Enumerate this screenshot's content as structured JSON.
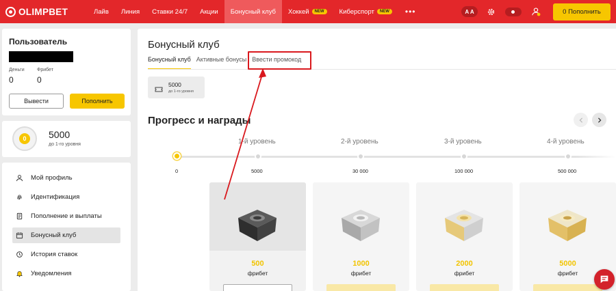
{
  "header": {
    "logo_text": "OLIMPBET",
    "nav": [
      {
        "label": "Лайв"
      },
      {
        "label": "Линия"
      },
      {
        "label": "Ставки 24/7"
      },
      {
        "label": "Акции"
      },
      {
        "label": "Бонусный клуб",
        "active": true
      },
      {
        "label": "Хоккей",
        "badge": "NEW"
      },
      {
        "label": "Киберспорт",
        "badge": "NEW"
      }
    ],
    "more": "•••",
    "font_toggle": "A A",
    "deposit_label": "0 Пополнить"
  },
  "user": {
    "title": "Пользователь",
    "money_label": "Деньги",
    "money_value": "0",
    "freebet_label": "Фрибет",
    "freebet_value": "0",
    "withdraw_label": "Вывести",
    "deposit_label": "Пополнить"
  },
  "bonus_summary": {
    "coin_symbol": "0",
    "points": "5000",
    "subtitle": "до 1-го уровня"
  },
  "menu": [
    {
      "label": "Мой профиль",
      "icon": "profile-icon"
    },
    {
      "label": "Идентификация",
      "icon": "fingerprint-icon"
    },
    {
      "label": "Пополнение и выплаты",
      "icon": "receipt-icon"
    },
    {
      "label": "Бонусный клуб",
      "icon": "calendar-icon",
      "active": true
    },
    {
      "label": "История ставок",
      "icon": "history-icon"
    },
    {
      "label": "Уведомления",
      "icon": "bell-icon"
    }
  ],
  "main": {
    "title": "Бонусный клуб",
    "tabs": [
      {
        "label": "Бонусный клуб",
        "active": true
      },
      {
        "label": "Активные бонусы"
      },
      {
        "label": "Ввести промокод",
        "highlighted": true
      }
    ],
    "points_chip": {
      "value": "5000",
      "subtitle": "до 1-го уровня"
    },
    "section_title": "Прогресс и награды",
    "levels": [
      "1-й уровень",
      "2-й уровень",
      "3-й уровень",
      "4-й уровень"
    ],
    "thresholds": [
      "0",
      "5000",
      "30 000",
      "100 000",
      "500 000"
    ],
    "rewards": [
      {
        "amount": "500",
        "unit": "фрибет",
        "tier": "dark"
      },
      {
        "amount": "1000",
        "unit": "фрибет",
        "tier": "silver"
      },
      {
        "amount": "2000",
        "unit": "фрибет",
        "tier": "gold-silver"
      },
      {
        "amount": "5000",
        "unit": "фрибет",
        "tier": "gold"
      }
    ]
  },
  "colors": {
    "brand_red": "#e3272a",
    "accent_yellow": "#f7c600",
    "annotation_red": "#d9181d"
  }
}
